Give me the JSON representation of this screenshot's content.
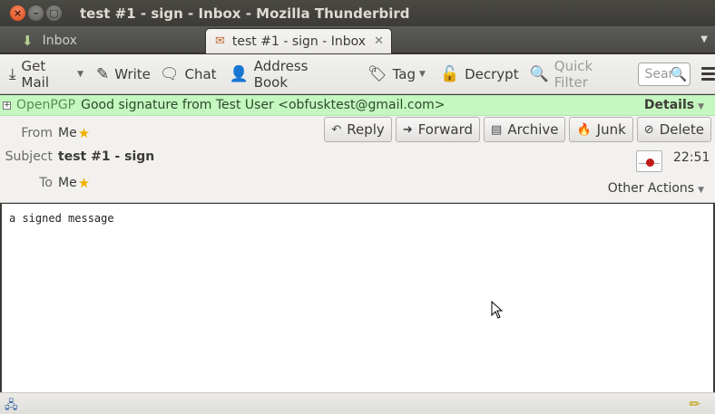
{
  "window": {
    "title": "test #1 - sign - Inbox - Mozilla Thunderbird",
    "close_glyph": "×",
    "min_glyph": "–",
    "max_glyph": "▢"
  },
  "tabs": [
    {
      "label": "Inbox",
      "active": false
    },
    {
      "label": "test #1 - sign - Inbox",
      "active": true
    }
  ],
  "toolbar": {
    "get_mail": "Get Mail",
    "write": "Write",
    "chat": "Chat",
    "address_book": "Address Book",
    "tag": "Tag",
    "decrypt": "Decrypt",
    "quick_filter": "Quick Filter",
    "search_placeholder": "Sear"
  },
  "openpgp": {
    "label": "OpenPGP",
    "message": "Good signature from Test User <obfusktest@gmail.com>",
    "details": "Details",
    "bar_color": "#c5f7c0"
  },
  "header": {
    "from_label": "From",
    "from_value": "Me",
    "subject_label": "Subject",
    "subject_value": "test #1 - sign",
    "to_label": "To",
    "to_value": "Me",
    "time": "22:51",
    "other_actions": "Other Actions",
    "actions": {
      "reply": "Reply",
      "forward": "Forward",
      "archive": "Archive",
      "junk": "Junk",
      "delete": "Delete"
    }
  },
  "body": {
    "text": "a signed message"
  },
  "colors": {
    "titlebar": "#3c3b37",
    "close_button": "#de4a17",
    "star": "#f0b000"
  }
}
